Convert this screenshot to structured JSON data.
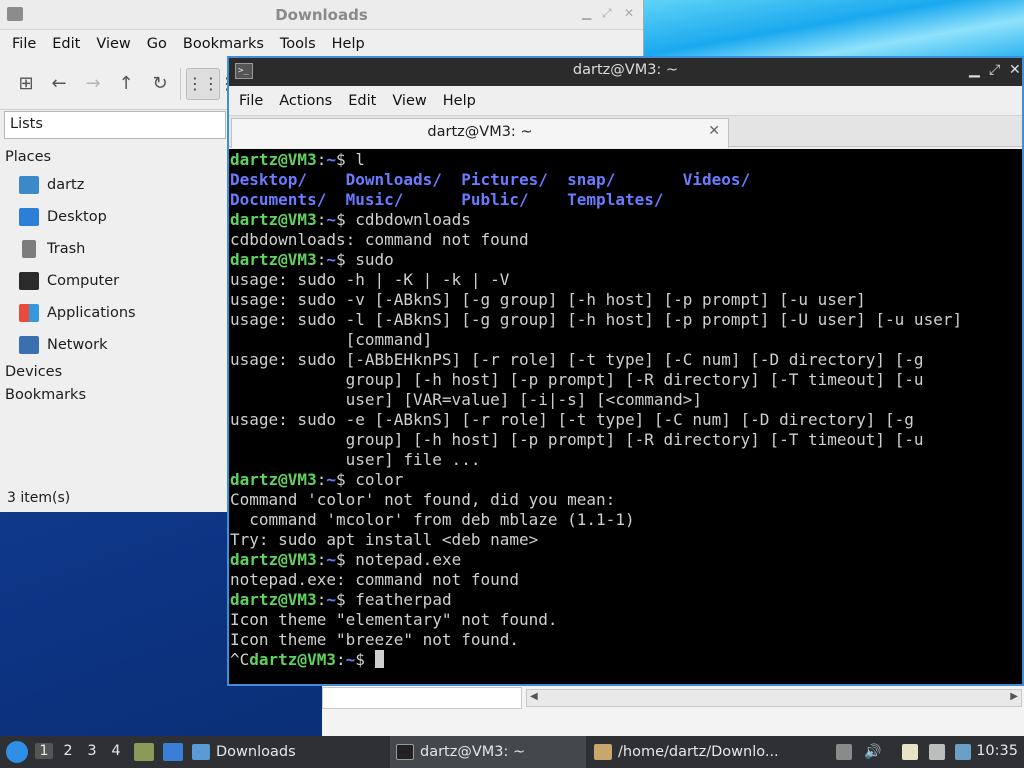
{
  "file_manager": {
    "title": "Downloads",
    "menu": [
      "File",
      "Edit",
      "View",
      "Go",
      "Bookmarks",
      "Tools",
      "Help"
    ],
    "location": "Lists",
    "places_header": "Places",
    "places": [
      {
        "label": "dartz",
        "icon": "home-folder-icon"
      },
      {
        "label": "Desktop",
        "icon": "desktop-icon"
      },
      {
        "label": "Trash",
        "icon": "trash-icon"
      },
      {
        "label": "Computer",
        "icon": "computer-icon"
      },
      {
        "label": "Applications",
        "icon": "applications-icon"
      },
      {
        "label": "Network",
        "icon": "network-icon"
      }
    ],
    "devices_header": "Devices",
    "bookmarks_header": "Bookmarks",
    "status": "3 item(s)"
  },
  "terminal": {
    "title": "dartz@VM3: ~",
    "menu": [
      "File",
      "Actions",
      "Edit",
      "View",
      "Help"
    ],
    "tab_label": "dartz@VM3: ~",
    "tab_close": "✕",
    "prompt_user": "dartz@VM3",
    "prompt_path": "~",
    "lines": [
      {
        "kind": "prompt",
        "cmd": "l"
      },
      {
        "kind": "ls",
        "cols": [
          "Desktop/",
          "Downloads/",
          "Pictures/",
          "snap/",
          "Videos/"
        ]
      },
      {
        "kind": "ls",
        "cols": [
          "Documents/",
          "Music/",
          "Public/",
          "Templates/"
        ]
      },
      {
        "kind": "prompt",
        "cmd": "cdbdownloads"
      },
      {
        "kind": "out",
        "text": "cdbdownloads: command not found"
      },
      {
        "kind": "prompt",
        "cmd": "sudo"
      },
      {
        "kind": "out",
        "text": "usage: sudo -h | -K | -k | -V"
      },
      {
        "kind": "out",
        "text": "usage: sudo -v [-ABknS] [-g group] [-h host] [-p prompt] [-u user]"
      },
      {
        "kind": "out",
        "text": "usage: sudo -l [-ABknS] [-g group] [-h host] [-p prompt] [-U user] [-u user]"
      },
      {
        "kind": "out",
        "text": "            [command]"
      },
      {
        "kind": "out",
        "text": "usage: sudo [-ABbEHknPS] [-r role] [-t type] [-C num] [-D directory] [-g"
      },
      {
        "kind": "out",
        "text": "            group] [-h host] [-p prompt] [-R directory] [-T timeout] [-u"
      },
      {
        "kind": "out",
        "text": "            user] [VAR=value] [-i|-s] [<command>]"
      },
      {
        "kind": "out",
        "text": "usage: sudo -e [-ABknS] [-r role] [-t type] [-C num] [-D directory] [-g"
      },
      {
        "kind": "out",
        "text": "            group] [-h host] [-p prompt] [-R directory] [-T timeout] [-u"
      },
      {
        "kind": "out",
        "text": "            user] file ..."
      },
      {
        "kind": "prompt",
        "cmd": "color"
      },
      {
        "kind": "out",
        "text": "Command 'color' not found, did you mean:"
      },
      {
        "kind": "out",
        "text": "  command 'mcolor' from deb mblaze (1.1-1)"
      },
      {
        "kind": "out",
        "text": "Try: sudo apt install <deb name>"
      },
      {
        "kind": "prompt",
        "cmd": "notepad.exe"
      },
      {
        "kind": "out",
        "text": "notepad.exe: command not found"
      },
      {
        "kind": "prompt",
        "cmd": "featherpad"
      },
      {
        "kind": "out",
        "text": "Icon theme \"elementary\" not found."
      },
      {
        "kind": "out",
        "text": "Icon theme \"breeze\" not found."
      },
      {
        "kind": "prompt_cursor",
        "prefix": "^C",
        "cmd": ""
      }
    ]
  },
  "taskbar": {
    "workspaces": [
      "1",
      "2",
      "3",
      "4"
    ],
    "tasks": [
      {
        "label": "Downloads",
        "icon": "folder-icon"
      },
      {
        "label": "dartz@VM3: ~",
        "icon": "terminal-icon"
      },
      {
        "label": "/home/dartz/Downlo...",
        "icon": "text-editor-icon"
      }
    ],
    "clock": "10:35"
  },
  "colors": {
    "prompt": "#5fd35f",
    "path": "#6b7bff",
    "directory": "#6b7bff",
    "window_focus_border": "#3f8fd8"
  }
}
